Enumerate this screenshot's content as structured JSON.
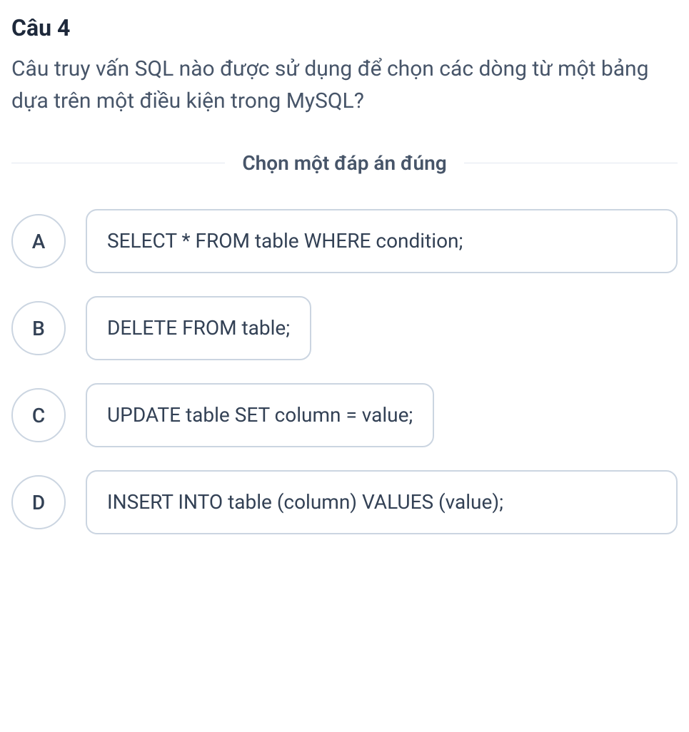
{
  "question": {
    "number": "Câu 4",
    "text": "Câu truy vấn SQL nào được sử dụng để chọn các dòng từ một bảng dựa trên một điều kiện trong MySQL?"
  },
  "instruction": "Chọn một đáp án đúng",
  "options": [
    {
      "letter": "A",
      "text": "SELECT * FROM table WHERE condition;"
    },
    {
      "letter": "B",
      "text": "DELETE FROM table;"
    },
    {
      "letter": "C",
      "text": "UPDATE table SET column = value;"
    },
    {
      "letter": "D",
      "text": "INSERT INTO table (column) VALUES (value);"
    }
  ]
}
